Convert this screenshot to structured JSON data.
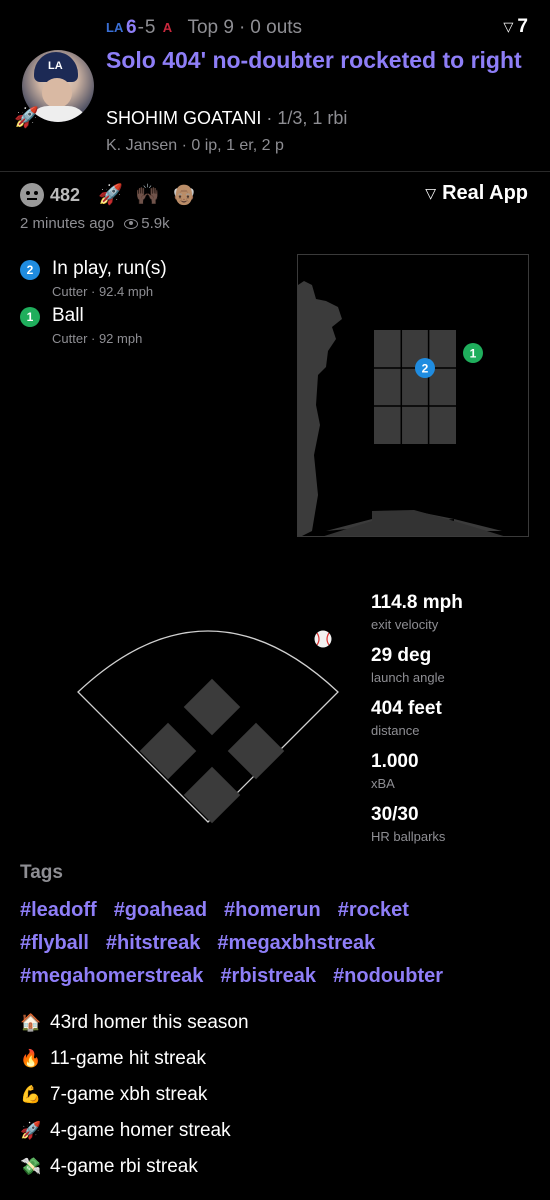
{
  "header": {
    "away_team_icon": "LA",
    "away_score": "6",
    "score_sep": "-",
    "home_score": "5",
    "home_team_icon": "A",
    "inning": "Top 9",
    "dot": "·",
    "outs": "0 outs",
    "pitch_count": "7",
    "headline": "Solo 404' no-doubter rocketed to right",
    "batter_name": "SHOHIM GOATANI",
    "batter_stats": " · 1/3, 1 rbi",
    "pitcher_line": "K. Jansen · 0 ip, 1 er, 2 p",
    "accent_color": "#8e7ef7",
    "avatar_badge": "🚀"
  },
  "reactions": {
    "count": "482",
    "emojis": [
      "🚀",
      "🙌🏿",
      "👴🏽"
    ],
    "real_app_label": "Real App",
    "time_ago": "2 minutes ago",
    "views": "5.9k"
  },
  "pitches": [
    {
      "num": "2",
      "result": "In play, run(s)",
      "detail": "Cutter ·  92.4 mph",
      "color": "#1f8ce0"
    },
    {
      "num": "1",
      "result": "Ball",
      "detail": "Cutter ·  92 mph",
      "color": "#1fae5c"
    }
  ],
  "stats": [
    {
      "value": "114.8 mph",
      "label": "exit velocity"
    },
    {
      "value": "29 deg",
      "label": "launch angle"
    },
    {
      "value": "404 feet",
      "label": "distance"
    },
    {
      "value": "1.000",
      "label": "xBA"
    },
    {
      "value": "30/30",
      "label": "HR ballparks"
    }
  ],
  "tags": {
    "title": "Tags",
    "rows": [
      [
        "#leadoff",
        "#goahead",
        "#homerun",
        "#rocket"
      ],
      [
        "#flyball",
        "#hitstreak",
        "#megaxbhstreak"
      ],
      [
        "#megahomerstreak",
        "#rbistreak",
        "#nodoubter"
      ]
    ]
  },
  "milestones": [
    {
      "icon": "🏠",
      "text": "43rd homer this season"
    },
    {
      "icon": "🔥",
      "text": "11-game hit streak"
    },
    {
      "icon": "💪",
      "text": "7-game xbh streak"
    },
    {
      "icon": "🚀",
      "text": "4-game homer streak"
    },
    {
      "icon": "💸",
      "text": "4-game rbi streak"
    }
  ]
}
